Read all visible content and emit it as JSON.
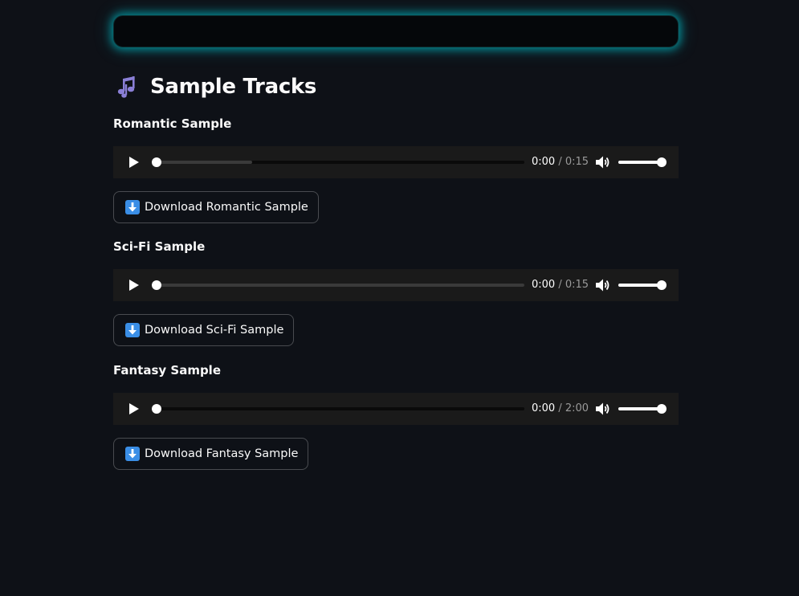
{
  "header": {
    "title": "Sample Tracks",
    "title_icon": "musical-notes-icon"
  },
  "tracks": [
    {
      "label": "Romantic Sample",
      "current_time": "0:00",
      "separator": "/",
      "duration": "0:15",
      "buffered_fraction": 0.26,
      "played_fraction": 0.0,
      "volume_fraction": 1.0,
      "download_label": "Download Romantic Sample"
    },
    {
      "label": "Sci-Fi Sample",
      "current_time": "0:00",
      "separator": "/",
      "duration": "0:15",
      "buffered_fraction": 1.0,
      "played_fraction": 0.0,
      "volume_fraction": 1.0,
      "download_label": "Download Sci-Fi Sample"
    },
    {
      "label": "Fantasy Sample",
      "current_time": "0:00",
      "separator": "/",
      "duration": "2:00",
      "buffered_fraction": 0.0,
      "played_fraction": 0.0,
      "volume_fraction": 1.0,
      "download_label": "Download Fantasy Sample"
    }
  ],
  "colors": {
    "background": "#0e1117",
    "glow": "#00c8d2",
    "player_bg": "#1a1a1a",
    "download_icon_bg": "#3a8ee6",
    "notes_icon": "#8a7fd6"
  },
  "icons": {
    "play": "play-icon",
    "volume": "volume-icon",
    "download": "download-arrow-icon"
  }
}
